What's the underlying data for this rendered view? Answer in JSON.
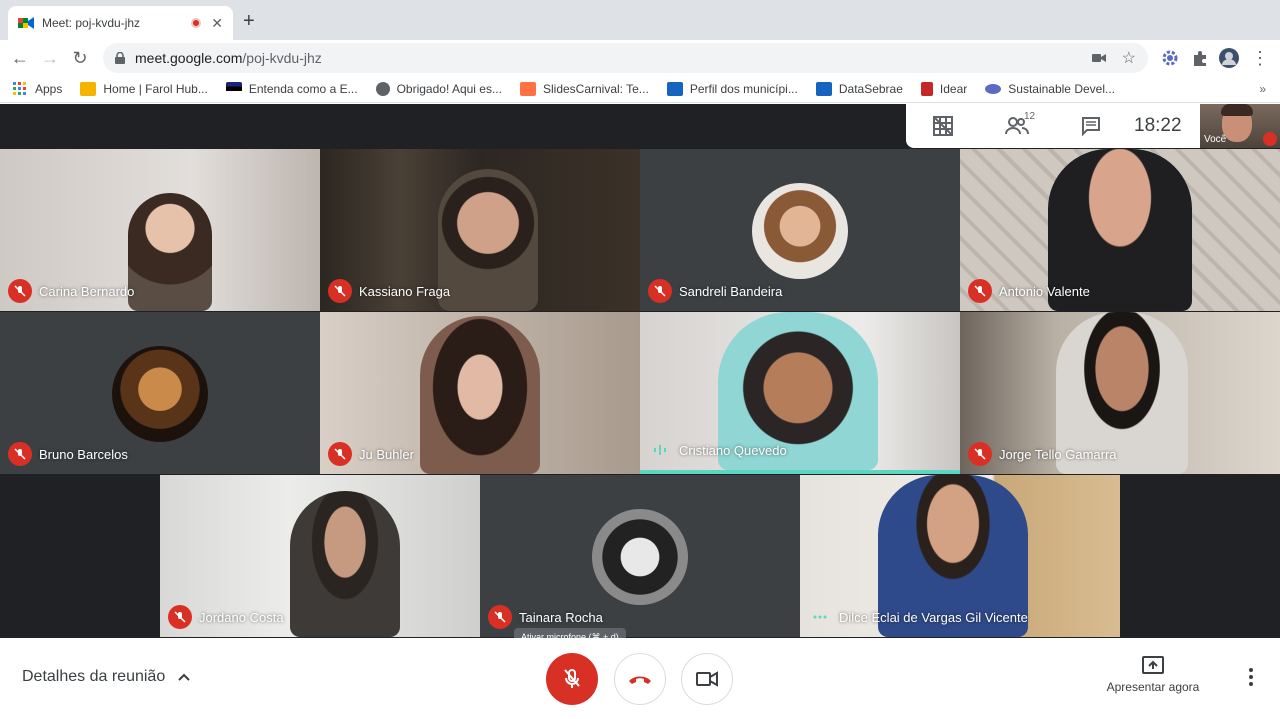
{
  "browser": {
    "tab_title": "Meet: poj-kvdu-jhz",
    "url_host": "meet.google.com",
    "url_path": "/poj-kvdu-jhz",
    "bookmarks": [
      {
        "label": "Apps",
        "icon": "apps-grid-icon",
        "color": "#4285f4"
      },
      {
        "label": "Home | Farol Hub...",
        "icon": "farol-icon",
        "color": "#f4b400"
      },
      {
        "label": "Entenda como a E...",
        "icon": "flag-icon",
        "color": "#1a237e"
      },
      {
        "label": "Obrigado! Aqui es...",
        "icon": "globe-icon",
        "color": "#5f6368"
      },
      {
        "label": "SlidesCarnival: Te...",
        "icon": "slides-icon",
        "color": "#ff7043"
      },
      {
        "label": "Perfil dos municípi...",
        "icon": "chart-icon",
        "color": "#1565c0"
      },
      {
        "label": "DataSebrae",
        "icon": "chart-icon",
        "color": "#1565c0"
      },
      {
        "label": "Idear",
        "icon": "idear-icon",
        "color": "#c62828"
      },
      {
        "label": "Sustainable Devel...",
        "icon": "un-icon",
        "color": "#5c6bc0"
      }
    ]
  },
  "meet": {
    "participant_count": "12",
    "clock": "18:22",
    "self_label": "Você",
    "participants": [
      {
        "name": "Carina Bernardo"
      },
      {
        "name": "Kassiano Fraga"
      },
      {
        "name": "Sandreli Bandeira"
      },
      {
        "name": "Antonio Valente"
      },
      {
        "name": "Bruno Barcelos"
      },
      {
        "name": "Ju Buhler"
      },
      {
        "name": "Cristiano Quevedo"
      },
      {
        "name": "Jorge Tello Gamarra"
      },
      {
        "name": "Jordano Costa"
      },
      {
        "name": "Tainara Rocha"
      },
      {
        "name": "Dilce Eclai de Vargas Gil Vicente"
      }
    ],
    "details_label": "Detalhes da reunião",
    "mic_tooltip": "Ativar microfone (⌘ + d)",
    "present_label": "Apresentar agora"
  }
}
